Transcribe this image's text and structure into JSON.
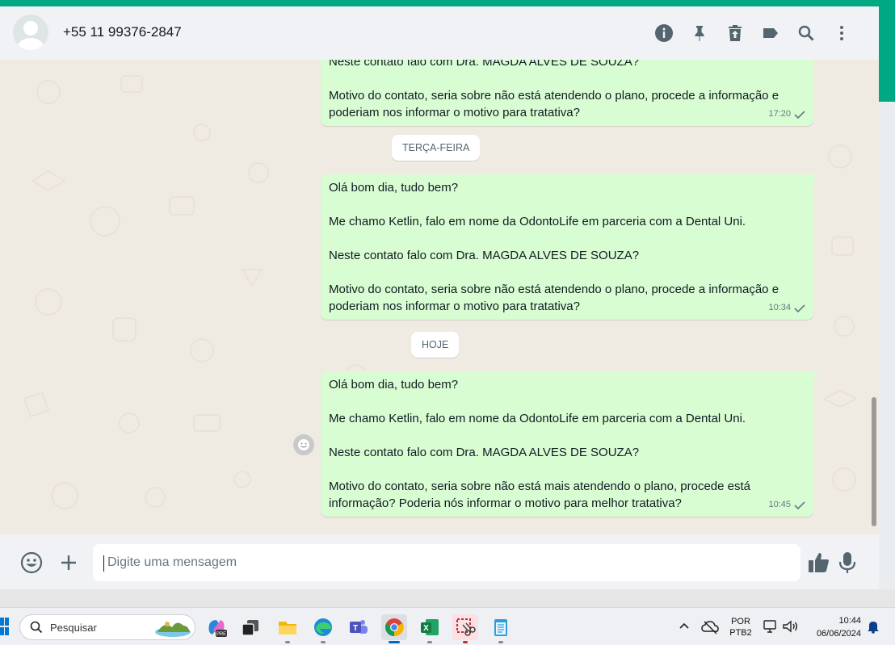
{
  "header": {
    "contact_name": "+55 11 99376-2847",
    "icons": [
      "info-icon",
      "pin-icon",
      "archive-icon",
      "label-icon",
      "search-icon",
      "menu-icon"
    ]
  },
  "messages": [
    {
      "lines": [
        "Neste contato falo com Dra. MAGDA ALVES DE SOUZA?",
        "",
        "Motivo do contato, seria sobre não está atendendo o plano, procede a informação e",
        "poderiam nos informar o motivo para tratativa?"
      ],
      "time": "17:20"
    },
    {
      "lines": [
        "Olá bom dia, tudo bem?",
        "",
        "Me chamo Ketlin, falo em nome da OdontoLife em parceria com a Dental Uni.",
        "",
        "Neste contato falo com Dra. MAGDA ALVES DE SOUZA?",
        "",
        "Motivo do contato, seria sobre não está atendendo o plano, procede a informação e",
        "poderiam nos informar o motivo para tratativa?"
      ],
      "time": "10:34"
    },
    {
      "lines": [
        "Olá bom dia, tudo bem?",
        "",
        "Me chamo Ketlin, falo em nome da OdontoLife em parceria com a Dental Uni.",
        "",
        "Neste contato falo com Dra. MAGDA ALVES DE SOUZA?",
        "",
        "Motivo do contato, seria sobre não está mais atendendo o plano, procede está",
        "informação? Poderia nós informar o motivo para melhor tratativa?"
      ],
      "time": "10:45"
    }
  ],
  "day_chips": [
    "TERÇA-FEIRA",
    "HOJE"
  ],
  "composer": {
    "placeholder": "Digite uma mensagem"
  },
  "taskbar": {
    "search_label": "Pesquisar",
    "language": "POR",
    "keyboard": "PTB2",
    "time": "10:44",
    "date": "06/06/2024"
  },
  "colors": {
    "accent": "#00a884",
    "outgoing_bubble": "#d9fdd3",
    "chat_background": "#efeae2"
  }
}
